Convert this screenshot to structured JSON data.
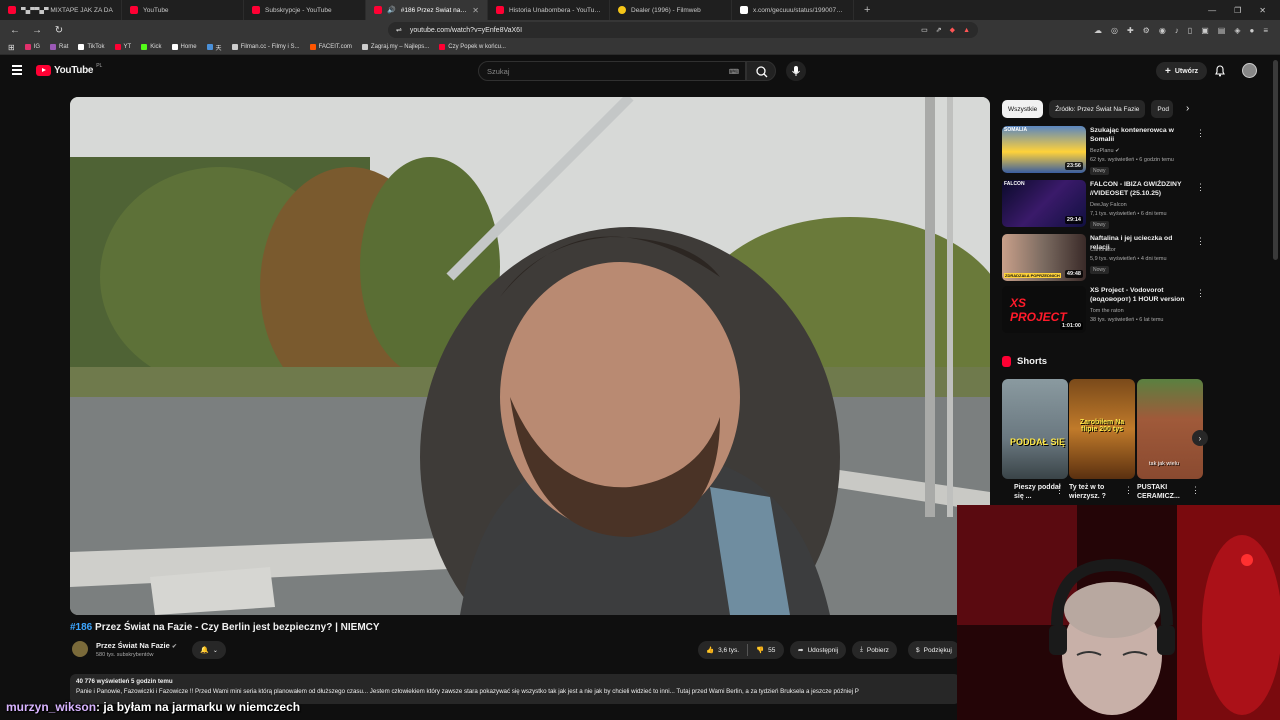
{
  "browser": {
    "tabs": [
      {
        "label": "▀▄▀▀▄▀ MIXTAPE JAK ZA DA",
        "favicon": "youtube-favicon",
        "active": false
      },
      {
        "label": "YouTube",
        "favicon": "youtube-favicon",
        "active": false
      },
      {
        "label": "Subskrypcje - YouTube",
        "favicon": "youtube-favicon",
        "active": false
      },
      {
        "label": "#186 Przez Świat na Fazie - C",
        "favicon": "youtube-favicon",
        "active": true
      },
      {
        "label": "Historia Unabombera - YouTube",
        "favicon": "youtube-favicon",
        "active": false
      },
      {
        "label": "Dealer (1996) - Filmweb",
        "favicon": "filmweb-favicon",
        "active": false
      },
      {
        "label": "x.com/gecuuu/status/1990076065",
        "favicon": "x-favicon",
        "active": false
      }
    ],
    "url": "youtube.com/watch?v=yEnfe8VaX6I",
    "bookmarks": [
      {
        "label": "IG",
        "color": "#e1306c"
      },
      {
        "label": "Rat",
        "color": "#9b59b6"
      },
      {
        "label": "TikTok",
        "color": "#ffffff"
      },
      {
        "label": "YT",
        "color": "#ff0033"
      },
      {
        "label": "Kick",
        "color": "#53fc18"
      },
      {
        "label": "Home",
        "color": "#ffffff"
      },
      {
        "label": "天",
        "color": "#4a90d9"
      },
      {
        "label": "Filman.cc - Filmy i S...",
        "color": "#cccccc"
      },
      {
        "label": "FACEIT.com",
        "color": "#ff5500"
      },
      {
        "label": "Zagraj.my – Najleps...",
        "color": "#cccccc"
      },
      {
        "label": "Czy Popek w końcu...",
        "color": "#ff0033"
      }
    ]
  },
  "youtube": {
    "logo_text": "YouTube",
    "country_code": "PL",
    "search_placeholder": "Szukaj",
    "create_label": "Utwórz"
  },
  "video": {
    "number": "#186",
    "title": "Przez Świat na Fazie - Czy Berlin jest bezpieczny? | NIEMCY",
    "channel_name": "Przez Świat Na Fazie",
    "subscribers": "580 tys. subskrybentów",
    "likes": "3,6 tys.",
    "dislikes": "55",
    "share_label": "Udostępnij",
    "download_label": "Pobierz",
    "thanks_label": "Podziękuj",
    "views_time": "40 776 wyświetleń  5 godzin temu",
    "description": "Panie i Panowie, Fazowiczki i Fazowicze !! Przed Wami mini seria którą planowałem od dłuższego czasu... Jestem człowiekiem który zawsze stara pokazywać się wszystko tak jak jest a nie jak by chcieli widzieć to inni... Tutaj przed Wami Berlin, a za tydzień Bruksela a jeszcze później P"
  },
  "sidebar": {
    "chips": [
      "Wszystkie",
      "Źródło: Przez Świat Na Fazie",
      "Pod"
    ],
    "recommendations": [
      {
        "title": "Szukając kontenerowca w Somalii",
        "channel": "BezPlanu",
        "verified": true,
        "views": "62 tys. wyświetleń • 6 godzin temu",
        "badge": "Nowy",
        "duration": "23:56",
        "thumb_overlay": "SOMALIA"
      },
      {
        "title": "FALCON - IBIZA GWIŹDZINY //VIDEOSET (25.10.25)",
        "channel": "DeeJay Falcon",
        "verified": false,
        "views": "7,1 tys. wyświetleń • 6 dni temu",
        "badge": "Nowy",
        "duration": "29:14",
        "thumb_overlay": "FALCON"
      },
      {
        "title": "Naftalina i jej ucieczka od relacji",
        "channel": "Carionator",
        "verified": false,
        "views": "5,9 tys. wyświetleń • 4 dni temu",
        "badge": "Nowy",
        "duration": "49:48",
        "thumb_overlay": "ZDRADZAŁA POPRZEDNICH"
      },
      {
        "title": "XS Project - Vodovorot (водоворот) 1 HOUR version",
        "channel": "Tom the raton",
        "verified": false,
        "views": "38 tys. wyświetleń • 6 lat temu",
        "badge": "",
        "duration": "1:01:00",
        "thumb_overlay": "XS PROJECT"
      }
    ],
    "shorts_header": "Shorts",
    "shorts": [
      {
        "title": "Pieszy poddał się ...",
        "overlay": "PODDAŁ SIĘ"
      },
      {
        "title": "Ty też w to wierzysz. ?",
        "overlay": "Zarobiłem Na flipie 200 tys"
      },
      {
        "title": "PUSTAKI CERAMICZ...",
        "overlay": "tak jak wielu"
      }
    ]
  },
  "chat": {
    "username": "murzyn_wikson",
    "message": ": ja byłam na jarmarku w niemczech"
  },
  "colors": {
    "brand_red": "#ff0033",
    "link_blue": "#3ea6ff",
    "background": "#0f0f0f",
    "chat_username": "#d8b4ff"
  }
}
